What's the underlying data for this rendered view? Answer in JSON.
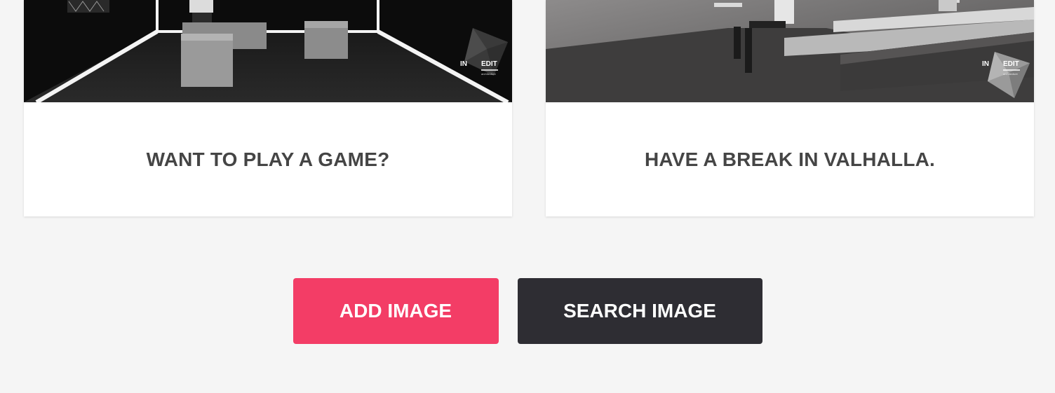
{
  "cards": [
    {
      "title": "WANT TO PLAY A GAME?",
      "image_alt": "dark room with glowing light strips and grey cube seating",
      "logo": {
        "left": "IN",
        "right": "EDIT",
        "sub": "architecture"
      }
    },
    {
      "title": "HAVE A BREAK IN VALHALLA.",
      "image_alt": "grey lounge with long bench seating and people reading",
      "logo": {
        "left": "IN",
        "right": "EDIT",
        "sub": "architecture"
      }
    }
  ],
  "buttons": {
    "add_label": "ADD IMAGE",
    "search_label": "SEARCH IMAGE"
  },
  "colors": {
    "background": "#f5f5f5",
    "card": "#ffffff",
    "title": "#454545",
    "add_button": "#f33d66",
    "search_button": "#2e2d33"
  }
}
